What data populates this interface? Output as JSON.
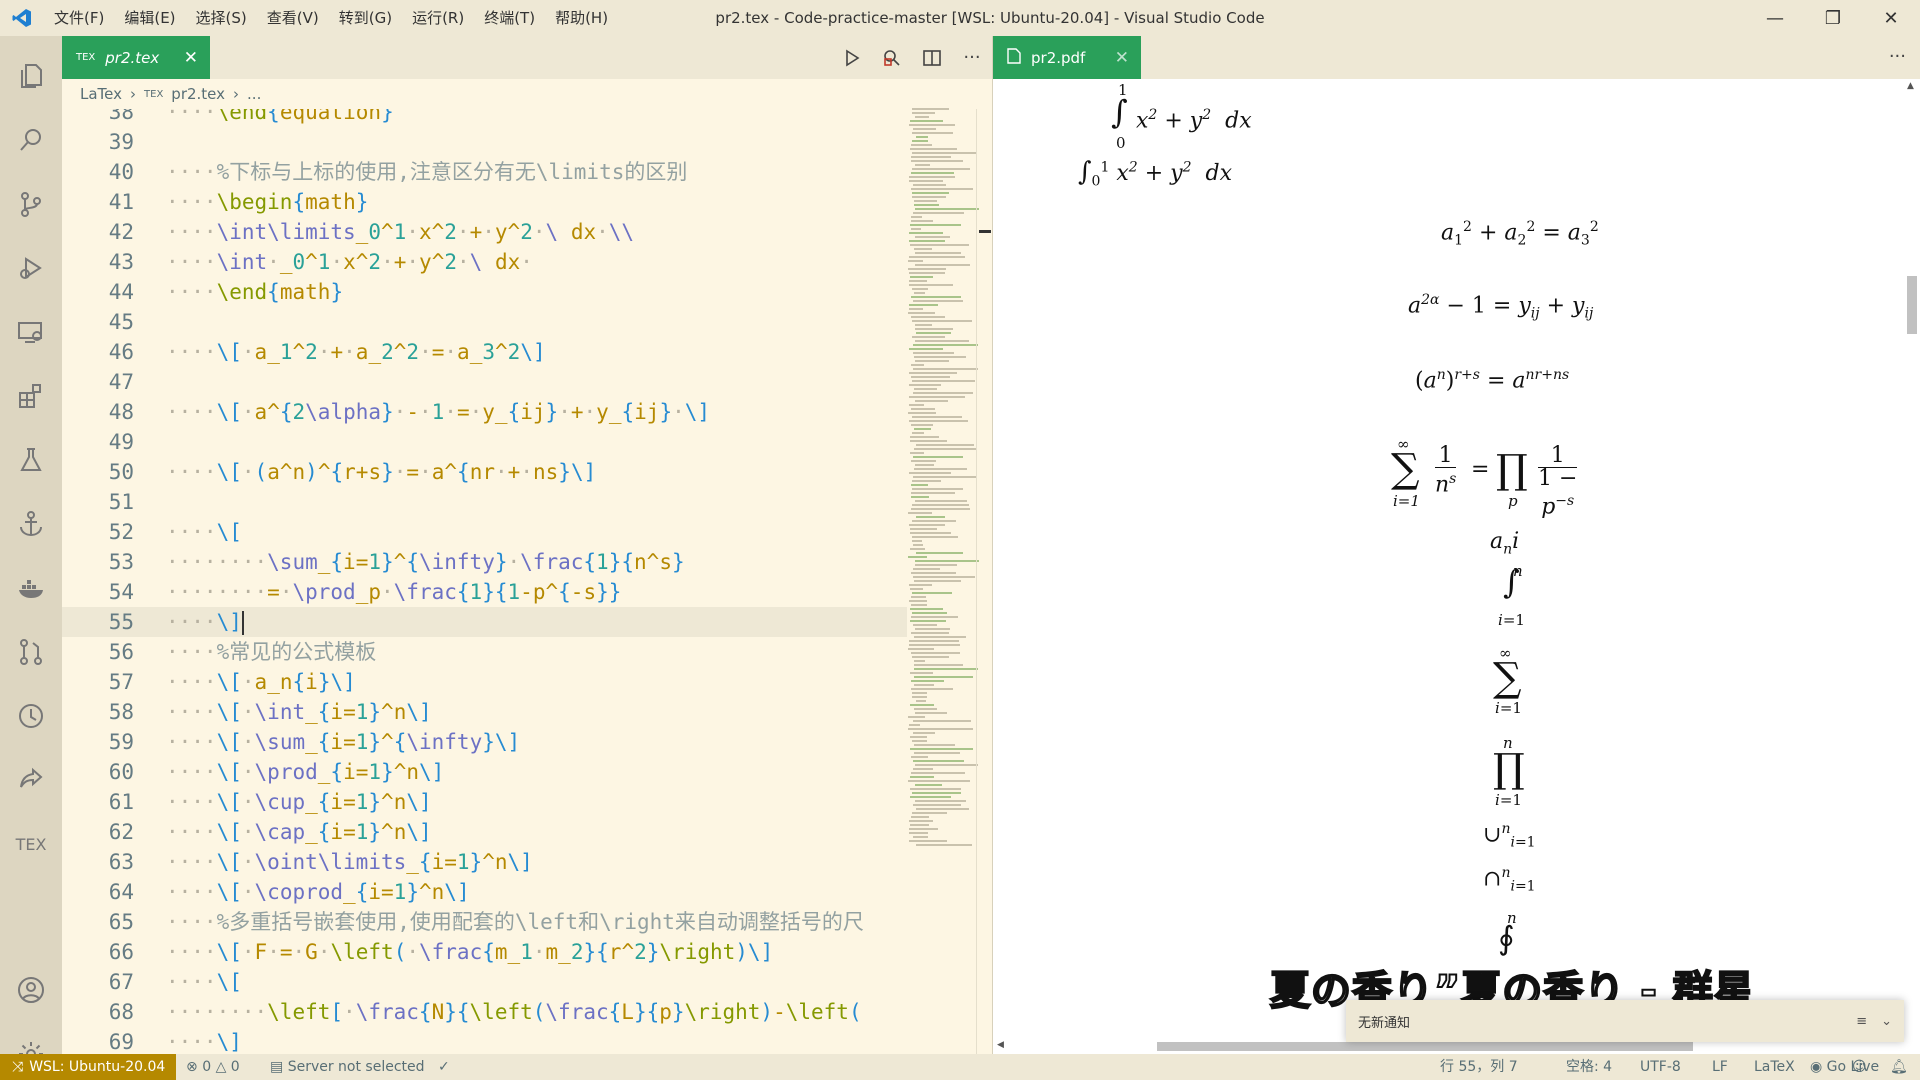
{
  "window": {
    "title": "pr2.tex - Code-practice-master [WSL: Ubuntu-20.04] - Visual Studio Code",
    "menu": [
      "文件(F)",
      "编辑(E)",
      "选择(S)",
      "查看(V)",
      "转到(G)",
      "运行(R)",
      "终端(T)",
      "帮助(H)"
    ],
    "controls": {
      "minimize": "—",
      "maximize": "❐",
      "close": "✕"
    }
  },
  "activity_bar": [
    "explorer-icon",
    "search-icon",
    "source-control-icon",
    "run-debug-icon",
    "remote-explorer-icon",
    "extensions-icon",
    "testing-icon",
    "anchor-icon",
    "docker-icon",
    "pull-request-icon",
    "timeline-icon",
    "live-share-icon",
    "tex-icon",
    "account-icon",
    "settings-gear-icon"
  ],
  "activity_tex_label": "TEX",
  "editor": {
    "tab": {
      "icon": "TEX",
      "label": "pr2.tex"
    },
    "breadcrumb": [
      "LaTex",
      "TEX",
      "pr2.tex",
      "..."
    ],
    "current_line": 55,
    "lines": [
      {
        "n": "38",
        "t": "\\end{equation}"
      },
      {
        "n": "39",
        "t": ""
      },
      {
        "n": "40",
        "t": "%下标与上标的使用,注意区分有无\\limits的区别"
      },
      {
        "n": "41",
        "t": "\\begin{math}"
      },
      {
        "n": "42",
        "t": "\\int\\limits_0^1 x^2 + y^2 \\ dx \\\\"
      },
      {
        "n": "43",
        "t": "\\int _0^1 x^2 + y^2 \\ dx "
      },
      {
        "n": "44",
        "t": "\\end{math}"
      },
      {
        "n": "45",
        "t": ""
      },
      {
        "n": "46",
        "t": "\\[ a_1^2 + a_2^2 = a_3^2\\]"
      },
      {
        "n": "47",
        "t": ""
      },
      {
        "n": "48",
        "t": "\\[ a^{2\\alpha} - 1 = y_{ij} + y_{ij} \\]"
      },
      {
        "n": "49",
        "t": ""
      },
      {
        "n": "50",
        "t": "\\[ (a^n)^{r+s} = a^{nr + ns}\\]"
      },
      {
        "n": "51",
        "t": ""
      },
      {
        "n": "52",
        "t": "\\["
      },
      {
        "n": "53",
        "t": "    \\sum_{i=1}^{\\infty} \\frac{1}{n^s}"
      },
      {
        "n": "54",
        "t": "    = \\prod_p \\frac{1}{1-p^{-s}}"
      },
      {
        "n": "55",
        "t": "\\]"
      },
      {
        "n": "56",
        "t": "%常见的公式模板"
      },
      {
        "n": "57",
        "t": "\\[ a_n{i}\\]"
      },
      {
        "n": "58",
        "t": "\\[ \\int_{i=1}^n\\]"
      },
      {
        "n": "59",
        "t": "\\[ \\sum_{i=1}^{\\infty}\\]"
      },
      {
        "n": "60",
        "t": "\\[ \\prod_{i=1}^n\\]"
      },
      {
        "n": "61",
        "t": "\\[ \\cup_{i=1}^n\\]"
      },
      {
        "n": "62",
        "t": "\\[ \\cap_{i=1}^n\\]"
      },
      {
        "n": "63",
        "t": "\\[ \\oint\\limits_{i=1}^n\\]"
      },
      {
        "n": "64",
        "t": "\\[ \\coprod_{i=1}^n\\]"
      },
      {
        "n": "65",
        "t": "%多重括号嵌套使用,使用配套的\\left和\\right来自动调整括号的尺"
      },
      {
        "n": "66",
        "t": "\\[ F = G \\left( \\frac{m_1 m_2}{r^2}\\right)\\]"
      },
      {
        "n": "67",
        "t": "\\["
      },
      {
        "n": "68",
        "t": "    \\left[ \\frac{N}{\\left(\\frac{L}{p}\\right)-\\left("
      },
      {
        "n": "69",
        "t": "\\]"
      }
    ]
  },
  "pdf": {
    "tab": {
      "label": "pr2.pdf"
    },
    "more": "···"
  },
  "overlay_lyric": "夏の香り”夏の香り - 群星",
  "notification": {
    "text": "无新通知"
  },
  "status": {
    "remote": "WSL: Ubuntu-20.04",
    "errors": "0",
    "warnings": "0",
    "server": "Server not selected",
    "check": "✓",
    "position": "行 55，列 7",
    "spaces": "空格: 4",
    "encoding": "UTF-8",
    "eol": "LF",
    "language": "LaTeX",
    "golive": "Go Live"
  },
  "colors": {
    "accent_green": "#2aa05a",
    "remote_bg": "#b58900",
    "editor_bg": "#fdf6e3",
    "chrome_bg": "#eee8d5"
  }
}
